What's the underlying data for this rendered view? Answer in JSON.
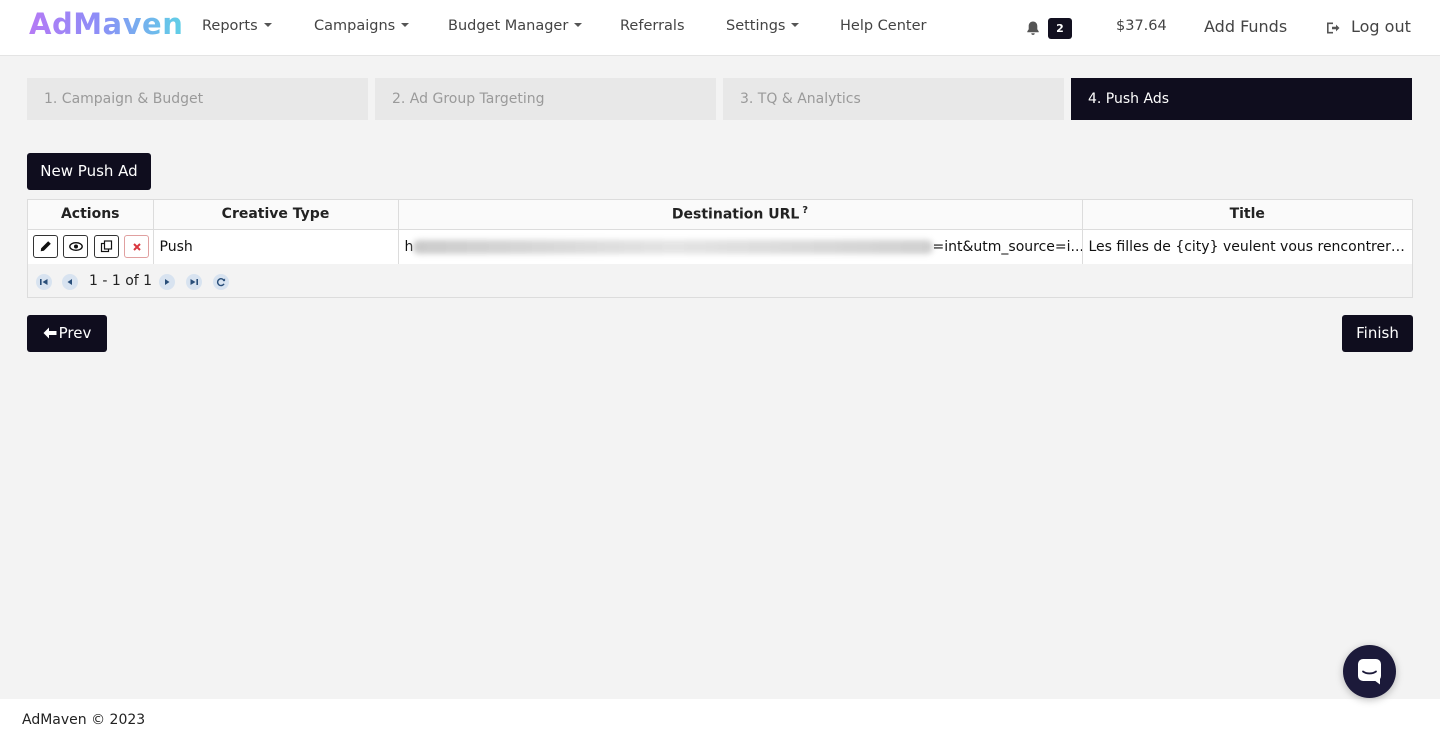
{
  "brand": {
    "name": "AdMaven"
  },
  "nav": {
    "reports": "Reports",
    "campaigns": "Campaigns",
    "budget_manager": "Budget Manager",
    "referrals": "Referrals",
    "settings": "Settings",
    "help_center": "Help Center",
    "notifications_count": "2",
    "balance": "$37.64",
    "add_funds": "Add Funds",
    "logout": "Log out"
  },
  "steps": [
    {
      "label": "1. Campaign & Budget",
      "active": false
    },
    {
      "label": "2. Ad Group Targeting",
      "active": false
    },
    {
      "label": "3. TQ & Analytics",
      "active": false
    },
    {
      "label": "4. Push Ads",
      "active": true
    }
  ],
  "new_button": "New Push Ad",
  "table": {
    "columns": [
      "Actions",
      "Creative Type",
      "Destination URL",
      "Title"
    ],
    "help_mark": "?",
    "rows": [
      {
        "creative_type": "Push",
        "url_prefix": "h",
        "url_suffix": "=int&utm_source=i...",
        "title": "Les filles de {city} veulent vous rencontrer ! pa..."
      }
    ],
    "pager": "1 - 1 of 1"
  },
  "prev_button": "Prev",
  "finish_button": "Finish",
  "footer": "AdMaven © 2023",
  "colors": {
    "dark": "#0f0d1e",
    "accent_start": "#b57af5",
    "accent_end": "#5fd0e6"
  }
}
